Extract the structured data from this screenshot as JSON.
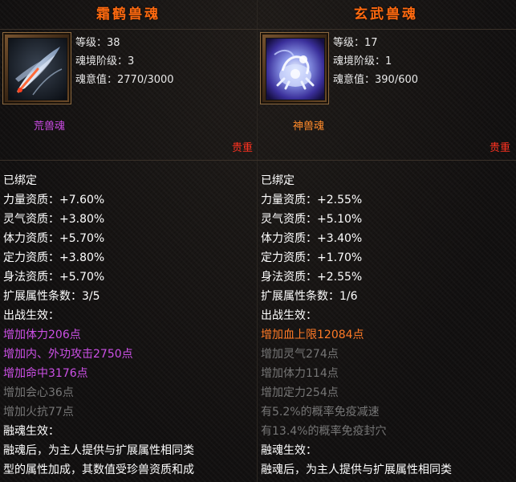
{
  "left": {
    "name": "霜鹤兽魂",
    "portrait_icon": "frost-crane-feather-icon",
    "stats": [
      "等级：38",
      "魂境阶级：3",
      "魂意值：2770/3000"
    ],
    "soul_type": "荒兽魂",
    "rarity": "贵重",
    "lines": [
      {
        "text": "已绑定",
        "color": "white"
      },
      {
        "text": "力量资质：+7.60%",
        "color": "white"
      },
      {
        "text": "灵气资质：+3.80%",
        "color": "white"
      },
      {
        "text": "体力资质：+5.70%",
        "color": "white"
      },
      {
        "text": "定力资质：+3.80%",
        "color": "white"
      },
      {
        "text": "身法资质：+5.70%",
        "color": "white"
      },
      {
        "text": "扩展属性条数：3/5",
        "color": "white"
      },
      {
        "text": "出战生效：",
        "color": "white"
      },
      {
        "text": "增加体力206点",
        "color": "purple"
      },
      {
        "text": "增加内、外功攻击2750点",
        "color": "purple"
      },
      {
        "text": "增加命中3176点",
        "color": "purple"
      },
      {
        "text": "增加会心36点",
        "color": "gray"
      },
      {
        "text": "增加火抗77点",
        "color": "gray"
      },
      {
        "text": "融魂生效：",
        "color": "white"
      },
      {
        "text": "融魂后，为主人提供与扩展属性相同类",
        "color": "white"
      },
      {
        "text": "型的属性加成，其数值受珍兽资质和成",
        "color": "white"
      }
    ]
  },
  "right": {
    "name": "玄武兽魂",
    "portrait_icon": "xuanwu-beast-icon",
    "stats": [
      "等级：17",
      "魂境阶级：1",
      "魂意值：390/600"
    ],
    "soul_type": "神兽魂",
    "rarity": "贵重",
    "lines": [
      {
        "text": "已绑定",
        "color": "white"
      },
      {
        "text": "力量资质：+2.55%",
        "color": "white"
      },
      {
        "text": "灵气资质：+5.10%",
        "color": "white"
      },
      {
        "text": "体力资质：+3.40%",
        "color": "white"
      },
      {
        "text": "定力资质：+1.70%",
        "color": "white"
      },
      {
        "text": "身法资质：+2.55%",
        "color": "white"
      },
      {
        "text": "扩展属性条数：1/6",
        "color": "white"
      },
      {
        "text": "出战生效：",
        "color": "white"
      },
      {
        "text": "增加血上限12084点",
        "color": "orange"
      },
      {
        "text": "增加灵气274点",
        "color": "gray"
      },
      {
        "text": "增加体力114点",
        "color": "gray"
      },
      {
        "text": "增加定力254点",
        "color": "gray"
      },
      {
        "text": "有5.2%的概率免疫减速",
        "color": "gray"
      },
      {
        "text": "有13.4%的概率免疫封穴",
        "color": "gray"
      },
      {
        "text": "融魂生效：",
        "color": "white"
      },
      {
        "text": "融魂后，为主人提供与扩展属性相同类",
        "color": "white"
      }
    ]
  },
  "colors": {
    "title": "#ff6a10",
    "rarity": "#ff3220",
    "purple": "#cc50e6",
    "orange": "#ff7a26",
    "gray": "#767676",
    "white": "#ffffff"
  }
}
